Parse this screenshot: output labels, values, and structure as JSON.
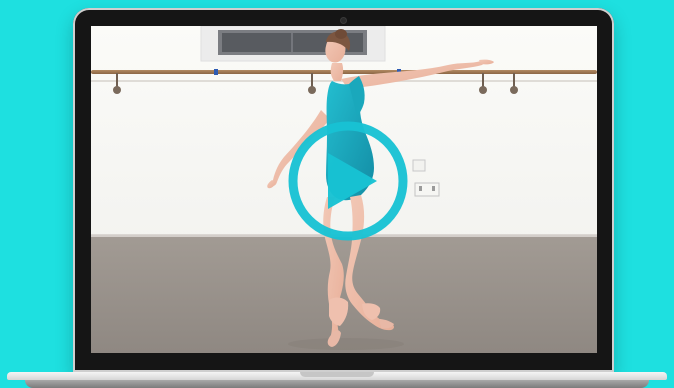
{
  "theme": {
    "background": "#1ee0e0",
    "accent": "#1ebfd1",
    "play_button_color": "#18c2d3"
  },
  "video": {
    "play_icon": "play-icon"
  }
}
